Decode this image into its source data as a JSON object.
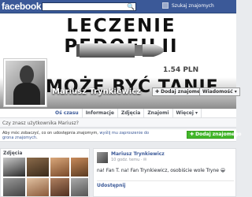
{
  "topbar": {
    "logo": "facebook",
    "search_glyph": "🔍",
    "find_friends": "Szukaj znajomych"
  },
  "cover": {
    "title": "LECZENIE PEDOFILII",
    "price": "1.54 PLN",
    "bottom_text": "MOŻE BYĆ TANIE"
  },
  "profile": {
    "name": "Mariusz Trynkiewicz",
    "add_friend": "✚ Dodaj znajomego",
    "message": "Wiadomość ▾"
  },
  "tabs": [
    {
      "label": "Oś czasu"
    },
    {
      "label": "Informacje"
    },
    {
      "label": "Zdjęcia"
    },
    {
      "label": "Znajomi"
    },
    {
      "label": "Więcej ▾"
    }
  ],
  "know_question": "Czy znasz użytkownika Mariusz?",
  "friend_prompt": {
    "text_a": "Aby móc zobaczyć, co on udostępnia znajomym, ",
    "link": "wyślij mu zaproszenie do grona znajomych",
    "text_b": ".",
    "button": "✚ Dodaj znajomego"
  },
  "photos": {
    "title": "Zdjęcia"
  },
  "post": {
    "author": "Mariusz Trynkiewicz",
    "meta": "10 godz. temu · ✉",
    "text": "na! Fan T. na! Fan Trynkiewicz, osobiście wole Tryne 😀",
    "action": "Udostępnij"
  },
  "colors": {
    "brand": "#3b5998",
    "green": "#42b72a"
  }
}
